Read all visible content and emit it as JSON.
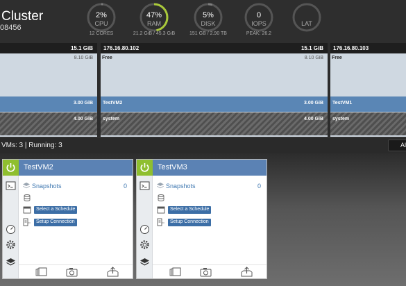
{
  "header": {
    "title": "Cluster",
    "id_fragment": "08456",
    "gauges": [
      {
        "value": "2%",
        "label": "CPU",
        "sub": "12 CORES",
        "fraction": 0.02,
        "color": "#7d7d7d"
      },
      {
        "value": "47%",
        "label": "RAM",
        "sub": "21.2 GiB / 45.3 GiB",
        "fraction": 0.47,
        "color": "#a9c93a"
      },
      {
        "value": "5%",
        "label": "DISK",
        "sub": "151 GB / 2.90 TB",
        "fraction": 0.05,
        "color": "#7d7d7d"
      },
      {
        "value": "0",
        "label": "IOPS",
        "sub": "PEAK: 26.2",
        "fraction": 0.0,
        "color": "#7d7d7d"
      },
      {
        "value": "",
        "label": "LAT",
        "sub": "",
        "fraction": 0.0,
        "color": "#7d7d7d"
      }
    ]
  },
  "hosts": [
    {
      "ip": "",
      "capacity": "15.1 GiB",
      "free_label": "",
      "free_size": "8.10 GiB",
      "vm_name": "",
      "vm_size": "3.00 GiB",
      "sys_name": "",
      "sys_size": "4.00 GiB"
    },
    {
      "ip": "176.16.80.102",
      "capacity": "15.1 GiB",
      "free_label": "Free",
      "free_size": "8.10 GiB",
      "vm_name": "TestVM2",
      "vm_size": "3.00 GiB",
      "sys_name": "system",
      "sys_size": "4.00 GiB"
    },
    {
      "ip": "176.16.80.103",
      "capacity": "",
      "free_label": "Free",
      "free_size": "",
      "vm_name": "TestVM1",
      "vm_size": "",
      "sys_name": "system",
      "sys_size": ""
    }
  ],
  "vm_bar": {
    "summary": "VMs: 3 | Running: 3",
    "filter_label": "Al"
  },
  "vms": [
    {
      "name": "TestVM2",
      "snapshots_label": "Snapshots",
      "snapshots_count": "0",
      "schedule_label": "Select a Schedule",
      "connection_label": "Setup Connection"
    },
    {
      "name": "TestVM3",
      "snapshots_label": "Snapshots",
      "snapshots_count": "0",
      "schedule_label": "Select a Schedule",
      "connection_label": "Setup Connection"
    }
  ],
  "icons": {
    "power": "power-icon",
    "side": [
      "console-icon",
      "dashboard-icon",
      "settings-icon",
      "layers-icon"
    ],
    "rows": [
      "snapshots-icon",
      "database-icon",
      "calendar-icon",
      "replication-icon"
    ],
    "footer": [
      "snapshot-list-icon",
      "camera-icon",
      "export-icon"
    ]
  },
  "colors": {
    "accent": "#5b82b4",
    "power_on": "#8fbf2f",
    "free_memory": "#cfd8e1",
    "vm_memory": "#5a86b5"
  }
}
